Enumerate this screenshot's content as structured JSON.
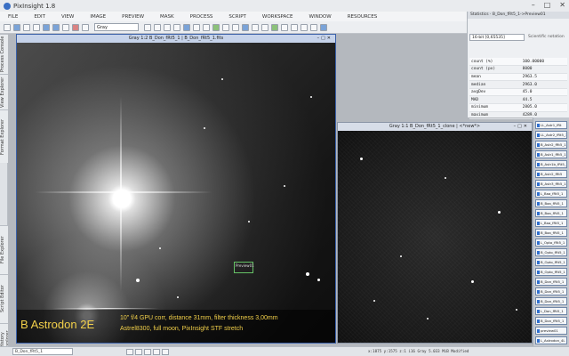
{
  "app": {
    "title": "PixInsight 1.8"
  },
  "menu": [
    "FILE",
    "EDIT",
    "VIEW",
    "IMAGE",
    "PREVIEW",
    "MASK",
    "PROCESS",
    "SCRIPT",
    "WORKSPACE",
    "WINDOW",
    "RESOURCES"
  ],
  "toolbar": {
    "view_mode": "Gray"
  },
  "left_tabs": [
    "Process Console",
    "View Explorer",
    "Format Explorer",
    "File Explorer",
    "Script Editor",
    "History Explorer"
  ],
  "window_main": {
    "title": "Gray 1:2 B_Don_fRt5_1 | B_Don_fRt5_1.fits"
  },
  "window_second": {
    "title": "Gray 1:1 B_Don_fRt5_1_clone | <*new*>"
  },
  "preview_label": "Preview01",
  "caption": {
    "title": "B Astrodon 2E",
    "line1": "10\" f/4 GPU corr, distance 31mm, filter thickness 3,00mm",
    "line2": "Astrel8300, full moon, PixInsight STF stretch"
  },
  "statistics": {
    "header": "Statistics",
    "target": "B_Don_fRt5_1->Preview01",
    "range": "16-bit [0,65535]",
    "option": "Scientific notation",
    "rows": [
      {
        "label": "count (%)",
        "value": "100.00000"
      },
      {
        "label": "count (px)",
        "value": "8000"
      },
      {
        "label": "mean",
        "value": "2963.5"
      },
      {
        "label": "median",
        "value": "2963.0"
      },
      {
        "label": "avgDev",
        "value": "45.0"
      },
      {
        "label": "MAD",
        "value": "44.5"
      },
      {
        "label": "minimum",
        "value": "2805.0"
      },
      {
        "label": "maximum",
        "value": "4289.0"
      }
    ]
  },
  "icons": [
    "LL_Astr1_fRt",
    "LL_Astr2_fRt5_1",
    "B_Astr2_fRt5_1",
    "B_Astr1_fRt5_1",
    "B_Astr1b_fRt5_1",
    "B_Astr2_fRt5",
    "B_Astr3_fRt5_1",
    "L_Baa_fRt5_1",
    "B_Baa_fRt5_1",
    "B_Baa_fRt5_1",
    "L_Baa_fRt5_1",
    "B_Baa_fRt5_1",
    "L_Opto_fRt5_1",
    "B_Opto_fRt5_1",
    "B_Opto_fRt5_1",
    "B_Opto_fRt5_1",
    "B_Don_fRt5_1",
    "B_Don_fRt5_1",
    "B_Don_fRt5_1",
    "L_Don_fRt5_1",
    "B_Don_fRt5_1",
    "preview01",
    "L_Astrodon_4L"
  ],
  "statusbar": {
    "view": "B_Don_fRt5_1",
    "info": "x:1875  y:1575  z:1  i16  Gray  5.033 MiB  Modified"
  },
  "colors": {
    "caption_text": "#f2d04a",
    "active_title": "#c6d3ea",
    "icon_accent": "#2f6fd0"
  }
}
